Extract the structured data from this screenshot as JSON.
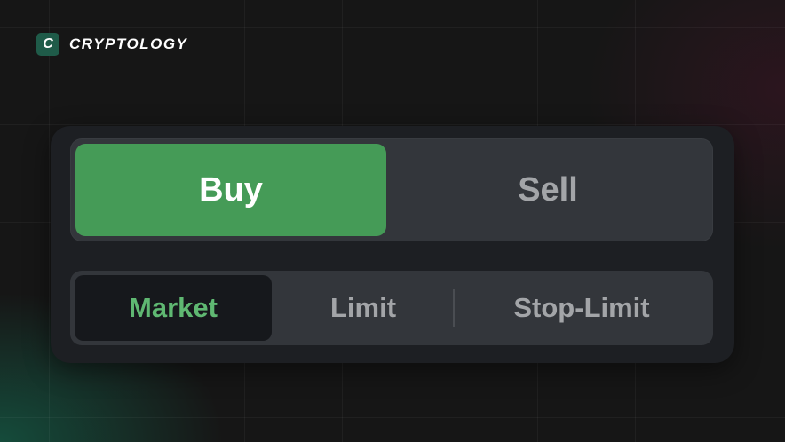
{
  "brand": {
    "mark": "C",
    "name": "CRYPTOLOGY",
    "mark_color": "#1f5b49"
  },
  "order_side": {
    "options": [
      {
        "label": "Buy",
        "selected": true
      },
      {
        "label": "Sell",
        "selected": false
      }
    ],
    "active_color": "#459b57"
  },
  "order_type": {
    "options": [
      {
        "label": "Market",
        "selected": true
      },
      {
        "label": "Limit",
        "selected": false
      },
      {
        "label": "Stop-Limit",
        "selected": false
      }
    ],
    "active_text_color": "#5fb872"
  }
}
